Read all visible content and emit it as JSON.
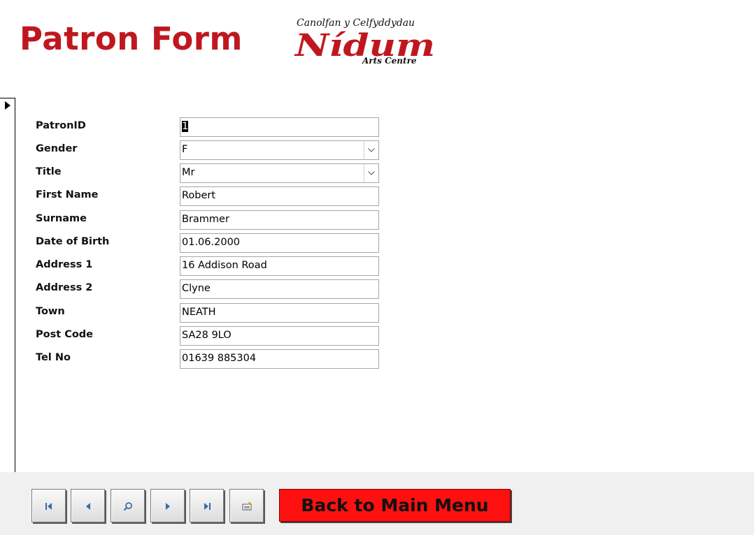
{
  "form": {
    "title": "Patron Form"
  },
  "logo": {
    "tagline": "Canolfan y Celfyddydau",
    "name": "Nídum",
    "subtitle": "Arts Centre",
    "color": "#c0171f"
  },
  "fields": {
    "patron_id": {
      "label": "PatronID",
      "value": "1"
    },
    "gender": {
      "label": "Gender",
      "value": "F"
    },
    "title": {
      "label": "Title",
      "value": "Mr"
    },
    "first_name": {
      "label": "First Name",
      "value": "Robert"
    },
    "surname": {
      "label": "Surname",
      "value": "Brammer"
    },
    "dob": {
      "label": "Date of Birth",
      "value": "01.06.2000"
    },
    "address1": {
      "label": "Address 1",
      "value": "16 Addison Road"
    },
    "address2": {
      "label": "Address 2",
      "value": "Clyne"
    },
    "town": {
      "label": "Town",
      "value": "NEATH"
    },
    "postcode": {
      "label": "Post Code",
      "value": "SA28 9LO"
    },
    "tel": {
      "label": "Tel No",
      "value": "01639 885304"
    }
  },
  "footer": {
    "nav_icons": [
      "first-record-icon",
      "previous-record-icon",
      "find-icon",
      "next-record-icon",
      "last-record-icon",
      "new-record-icon"
    ],
    "menu_button": {
      "label": "Back to Main Menu",
      "color": "#ff1010"
    }
  }
}
